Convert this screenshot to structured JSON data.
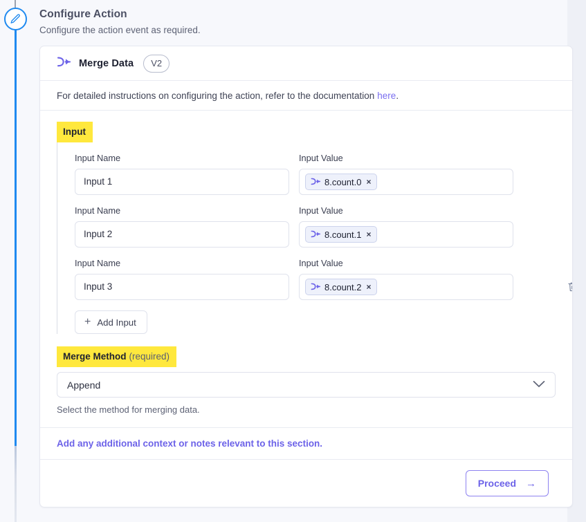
{
  "header": {
    "title": "Configure Action",
    "subtitle": "Configure the action event as required."
  },
  "rail": {
    "node_icon": "pencil-edit-icon",
    "line_color": "#1f8af0"
  },
  "card": {
    "icon": "merge-data-icon",
    "title": "Merge Data",
    "version_badge": "V2",
    "doc_text": "For detailed instructions on configuring the action, refer to the documentation",
    "doc_link": "here",
    "doc_suffix": "."
  },
  "input_section": {
    "label": "Input",
    "highlight_color": "#ffe83d",
    "name_label": "Input Name",
    "value_label": "Input Value",
    "rows": [
      {
        "name": "Input 1",
        "token": "8.count.0",
        "token_icon": "merge-data-icon",
        "close": "×",
        "deletable": false
      },
      {
        "name": "Input 2",
        "token": "8.count.1",
        "token_icon": "merge-data-icon",
        "close": "×",
        "deletable": false
      },
      {
        "name": "Input 3",
        "token": "8.count.2",
        "token_icon": "merge-data-icon",
        "close": "×",
        "deletable": true
      }
    ],
    "add_button": {
      "plus": "+",
      "label": "Add Input"
    },
    "delete_icon": "trash-icon"
  },
  "merge_method": {
    "label": "Merge Method",
    "required_text": "(required)",
    "highlight_color": "#ffe83d",
    "selected": "Append",
    "chevron": "chevron-down-icon",
    "helper": "Select the method for merging data."
  },
  "notes": {
    "text": "Add any additional context or notes relevant to this section."
  },
  "footer": {
    "proceed_label": "Proceed",
    "proceed_arrow": "→"
  },
  "colors": {
    "accent_purple": "#6c62e8",
    "rail_blue": "#1f8af0",
    "highlight_yellow": "#ffe83d",
    "page_bg": "#f7f8fc"
  }
}
